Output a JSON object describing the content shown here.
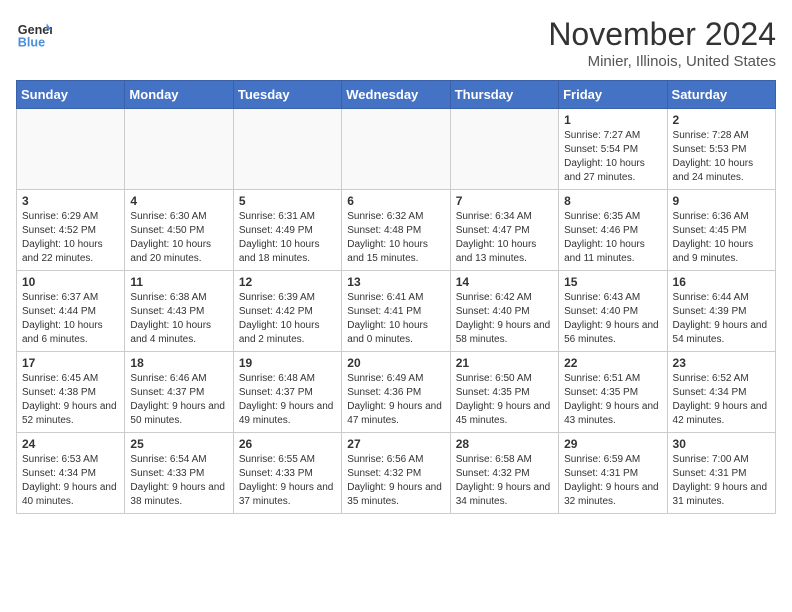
{
  "logo": {
    "line1": "General",
    "line2": "Blue"
  },
  "title": "November 2024",
  "location": "Minier, Illinois, United States",
  "weekdays": [
    "Sunday",
    "Monday",
    "Tuesday",
    "Wednesday",
    "Thursday",
    "Friday",
    "Saturday"
  ],
  "weeks": [
    [
      {
        "day": "",
        "info": ""
      },
      {
        "day": "",
        "info": ""
      },
      {
        "day": "",
        "info": ""
      },
      {
        "day": "",
        "info": ""
      },
      {
        "day": "",
        "info": ""
      },
      {
        "day": "1",
        "info": "Sunrise: 7:27 AM\nSunset: 5:54 PM\nDaylight: 10 hours and 27 minutes."
      },
      {
        "day": "2",
        "info": "Sunrise: 7:28 AM\nSunset: 5:53 PM\nDaylight: 10 hours and 24 minutes."
      }
    ],
    [
      {
        "day": "3",
        "info": "Sunrise: 6:29 AM\nSunset: 4:52 PM\nDaylight: 10 hours and 22 minutes."
      },
      {
        "day": "4",
        "info": "Sunrise: 6:30 AM\nSunset: 4:50 PM\nDaylight: 10 hours and 20 minutes."
      },
      {
        "day": "5",
        "info": "Sunrise: 6:31 AM\nSunset: 4:49 PM\nDaylight: 10 hours and 18 minutes."
      },
      {
        "day": "6",
        "info": "Sunrise: 6:32 AM\nSunset: 4:48 PM\nDaylight: 10 hours and 15 minutes."
      },
      {
        "day": "7",
        "info": "Sunrise: 6:34 AM\nSunset: 4:47 PM\nDaylight: 10 hours and 13 minutes."
      },
      {
        "day": "8",
        "info": "Sunrise: 6:35 AM\nSunset: 4:46 PM\nDaylight: 10 hours and 11 minutes."
      },
      {
        "day": "9",
        "info": "Sunrise: 6:36 AM\nSunset: 4:45 PM\nDaylight: 10 hours and 9 minutes."
      }
    ],
    [
      {
        "day": "10",
        "info": "Sunrise: 6:37 AM\nSunset: 4:44 PM\nDaylight: 10 hours and 6 minutes."
      },
      {
        "day": "11",
        "info": "Sunrise: 6:38 AM\nSunset: 4:43 PM\nDaylight: 10 hours and 4 minutes."
      },
      {
        "day": "12",
        "info": "Sunrise: 6:39 AM\nSunset: 4:42 PM\nDaylight: 10 hours and 2 minutes."
      },
      {
        "day": "13",
        "info": "Sunrise: 6:41 AM\nSunset: 4:41 PM\nDaylight: 10 hours and 0 minutes."
      },
      {
        "day": "14",
        "info": "Sunrise: 6:42 AM\nSunset: 4:40 PM\nDaylight: 9 hours and 58 minutes."
      },
      {
        "day": "15",
        "info": "Sunrise: 6:43 AM\nSunset: 4:40 PM\nDaylight: 9 hours and 56 minutes."
      },
      {
        "day": "16",
        "info": "Sunrise: 6:44 AM\nSunset: 4:39 PM\nDaylight: 9 hours and 54 minutes."
      }
    ],
    [
      {
        "day": "17",
        "info": "Sunrise: 6:45 AM\nSunset: 4:38 PM\nDaylight: 9 hours and 52 minutes."
      },
      {
        "day": "18",
        "info": "Sunrise: 6:46 AM\nSunset: 4:37 PM\nDaylight: 9 hours and 50 minutes."
      },
      {
        "day": "19",
        "info": "Sunrise: 6:48 AM\nSunset: 4:37 PM\nDaylight: 9 hours and 49 minutes."
      },
      {
        "day": "20",
        "info": "Sunrise: 6:49 AM\nSunset: 4:36 PM\nDaylight: 9 hours and 47 minutes."
      },
      {
        "day": "21",
        "info": "Sunrise: 6:50 AM\nSunset: 4:35 PM\nDaylight: 9 hours and 45 minutes."
      },
      {
        "day": "22",
        "info": "Sunrise: 6:51 AM\nSunset: 4:35 PM\nDaylight: 9 hours and 43 minutes."
      },
      {
        "day": "23",
        "info": "Sunrise: 6:52 AM\nSunset: 4:34 PM\nDaylight: 9 hours and 42 minutes."
      }
    ],
    [
      {
        "day": "24",
        "info": "Sunrise: 6:53 AM\nSunset: 4:34 PM\nDaylight: 9 hours and 40 minutes."
      },
      {
        "day": "25",
        "info": "Sunrise: 6:54 AM\nSunset: 4:33 PM\nDaylight: 9 hours and 38 minutes."
      },
      {
        "day": "26",
        "info": "Sunrise: 6:55 AM\nSunset: 4:33 PM\nDaylight: 9 hours and 37 minutes."
      },
      {
        "day": "27",
        "info": "Sunrise: 6:56 AM\nSunset: 4:32 PM\nDaylight: 9 hours and 35 minutes."
      },
      {
        "day": "28",
        "info": "Sunrise: 6:58 AM\nSunset: 4:32 PM\nDaylight: 9 hours and 34 minutes."
      },
      {
        "day": "29",
        "info": "Sunrise: 6:59 AM\nSunset: 4:31 PM\nDaylight: 9 hours and 32 minutes."
      },
      {
        "day": "30",
        "info": "Sunrise: 7:00 AM\nSunset: 4:31 PM\nDaylight: 9 hours and 31 minutes."
      }
    ]
  ]
}
